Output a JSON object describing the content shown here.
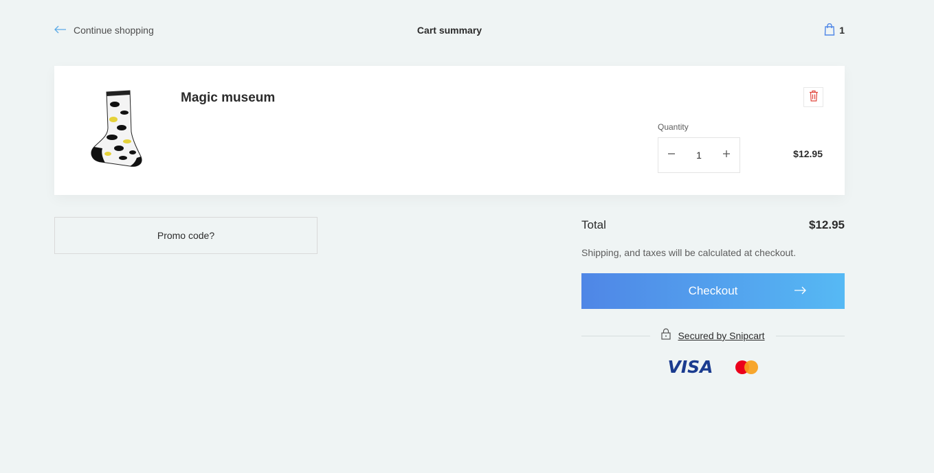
{
  "header": {
    "back_label": "Continue shopping",
    "title": "Cart summary",
    "cart_count": "1"
  },
  "item": {
    "name": "Magic museum",
    "quantity_label": "Quantity",
    "quantity": "1",
    "price": "$12.95",
    "image": "sock-product-image"
  },
  "promo": {
    "label": "Promo code?"
  },
  "summary": {
    "total_label": "Total",
    "total_value": "$12.95",
    "shipping_note": "Shipping, and taxes will be calculated at checkout.",
    "checkout_label": "Checkout",
    "secured_label": "Secured by Snipcart",
    "visa_label": "VISA"
  },
  "colors": {
    "background": "#eff4f4",
    "accent_start": "#4f86e6",
    "accent_end": "#56b9f4",
    "remove": "#e0453a"
  }
}
